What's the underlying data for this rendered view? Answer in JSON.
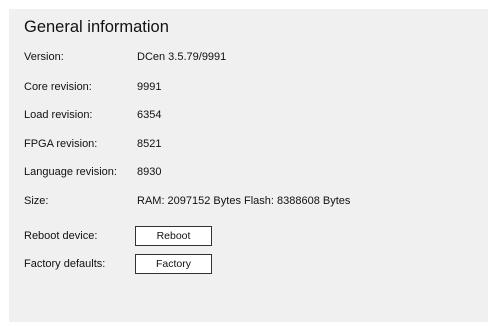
{
  "panel": {
    "title": "General information"
  },
  "info": [
    {
      "label": "Version:",
      "value": "DCen 3.5.79/9991"
    },
    {
      "label": "Core revision:",
      "value": "9991"
    },
    {
      "label": "Load revision:",
      "value": "6354"
    },
    {
      "label": "FPGA revision:",
      "value": "8521"
    },
    {
      "label": "Language revision:",
      "value": "8930"
    },
    {
      "label": "Size:",
      "value": "RAM: 2097152 Bytes Flash: 8388608 Bytes"
    }
  ],
  "actions": {
    "reboot_label": "Reboot device:",
    "reboot_button": "Reboot",
    "factory_label": "Factory defaults:",
    "factory_button": "Factory"
  }
}
